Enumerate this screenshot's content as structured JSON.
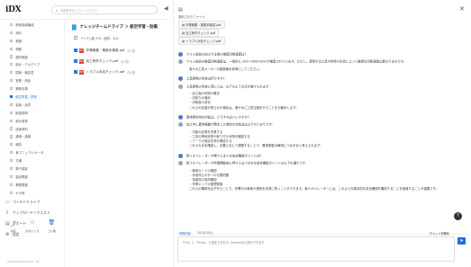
{
  "app": {
    "logo": "iDX",
    "search_placeholder": "検索条件を入力してください",
    "collapse_icon": "◀"
  },
  "sidebar": {
    "tree": [
      {
        "label": "現地指導機能"
      },
      {
        "label": "資料"
      },
      {
        "label": "発図"
      },
      {
        "label": "規程"
      },
      {
        "label": "契約関連"
      },
      {
        "label": "設計・アカデミア"
      },
      {
        "label": "提案・報告書"
      },
      {
        "label": "営業・商談"
      },
      {
        "label": "業務手順"
      },
      {
        "label": "航空学習・防衛",
        "active": true
      },
      {
        "label": "製造・品質"
      },
      {
        "label": "取扱説明"
      },
      {
        "label": "設計基準"
      },
      {
        "label": "技術資料"
      },
      {
        "label": "通達・連絡"
      },
      {
        "label": "報告"
      },
      {
        "label": "食マニュアル/ケータ"
      },
      {
        "label": "共通"
      },
      {
        "label": "電子認証"
      },
      {
        "label": "製品関連"
      },
      {
        "label": "業務関連"
      },
      {
        "label": "その他"
      }
    ],
    "sections": [
      {
        "label": "ゴールドドライブ",
        "icon": "▭"
      },
      {
        "label": "アップロードリクエスト",
        "icon": "⇪"
      },
      {
        "label": "レポート",
        "icon": "▤"
      },
      {
        "label": "設定",
        "icon": "⚙"
      }
    ],
    "actions": [
      {
        "label": "共有",
        "icon": "⤴"
      },
      {
        "label": "お気に入り",
        "icon": "☆"
      },
      {
        "label": "ゴミ箱",
        "icon": "🗑"
      }
    ],
    "copyright": "Copyright©2024 LAC Co., Ltd."
  },
  "center": {
    "title": "ナレッジチームドライブ ＞ 航空学習・防衛",
    "subtitle": "アイテム数 3 件（選択：3/3）",
    "files": [
      {
        "name": "作業概要・業務手順書.pdf"
      },
      {
        "name": "加工条件チェック.pdf"
      },
      {
        "name": "トラブル対応チェック.pdf"
      }
    ]
  },
  "chat": {
    "selected_label": "選択されたファイル",
    "selected_files": [
      "作業概要・業務手順書.pdf",
      "加工条件チェック.pdf",
      "トラブル対応チェック.pdf"
    ],
    "messages": [
      {
        "kind": "q",
        "text": "アルミ部品の加工する際の推奨切削速度は？"
      },
      {
        "kind": "a",
        "text": "アルミ部品の推奨切削速度は、一般的に 200〜500m/minが推奨されています。ただし、使用する工具や材質や形状によって最適な切削速度は異なりますので、"
      },
      {
        "kind": "ind",
        "text": "各々の工具メーカーの推奨値を参考にしてください。"
      },
      {
        "kind": "q",
        "text": "工具摩耗の判定は何ですか？"
      },
      {
        "kind": "a",
        "text": "工具摩耗の判定に関しては、以下のような点が挙げられます："
      },
      {
        "kind": "li",
        "text": "・加工面の状態の悪化"
      },
      {
        "kind": "li",
        "text": "・切削力の増加"
      },
      {
        "kind": "li",
        "text": "・切削音の変化"
      },
      {
        "kind": "ind",
        "text": "これらの兆候が見られた場合は、速やかに工具交換を行うことをお勧めします。"
      },
      {
        "kind": "q",
        "text": "異常発生時の対処は、どうすればいいですか？"
      },
      {
        "kind": "a",
        "text": "加工中に異常振動が発生した場合の対処法は以下のとおりです："
      },
      {
        "kind": "li",
        "text": "・次動の記録を作業する"
      },
      {
        "kind": "li",
        "text": "・工具の摩耗状態や取り付け状態を確認する"
      },
      {
        "kind": "li",
        "text": "・ワークの固定状態を確認する"
      },
      {
        "kind": "ind",
        "text": "これらの点を確認し、必要に応じて調整することで、異常振動の解消につながると考えられます。"
      },
      {
        "kind": "q",
        "text": "新人オペレーターが押さえるべき安全確認ポイントは？"
      },
      {
        "kind": "a",
        "text": "新人オペレーターが作業開始前に押さえるべき主な安全確認ポイントは以下の通りです："
      },
      {
        "kind": "li",
        "text": "・機械ガードの確認"
      },
      {
        "kind": "li",
        "text": "・非常停止ボタンの位置把握"
      },
      {
        "kind": "li",
        "text": "・保護具の着用確認"
      },
      {
        "kind": "li",
        "text": "・作業エリアの整理整頓"
      },
      {
        "kind": "ind",
        "text": "これらの確認を必ず行うことで、作業中の事故や怪我を未然に防ぐことができます。新人オペレーターには、このような基本的な安全確認を徹底することを指導することが重要です。"
      }
    ],
    "input": {
      "label": "質問内容",
      "count": "1876/2000",
      "placeholder": "「Ctrl」と「Enter」で送信できます。Enterのみで改行できます",
      "reset_label": "チャット初期化"
    }
  }
}
